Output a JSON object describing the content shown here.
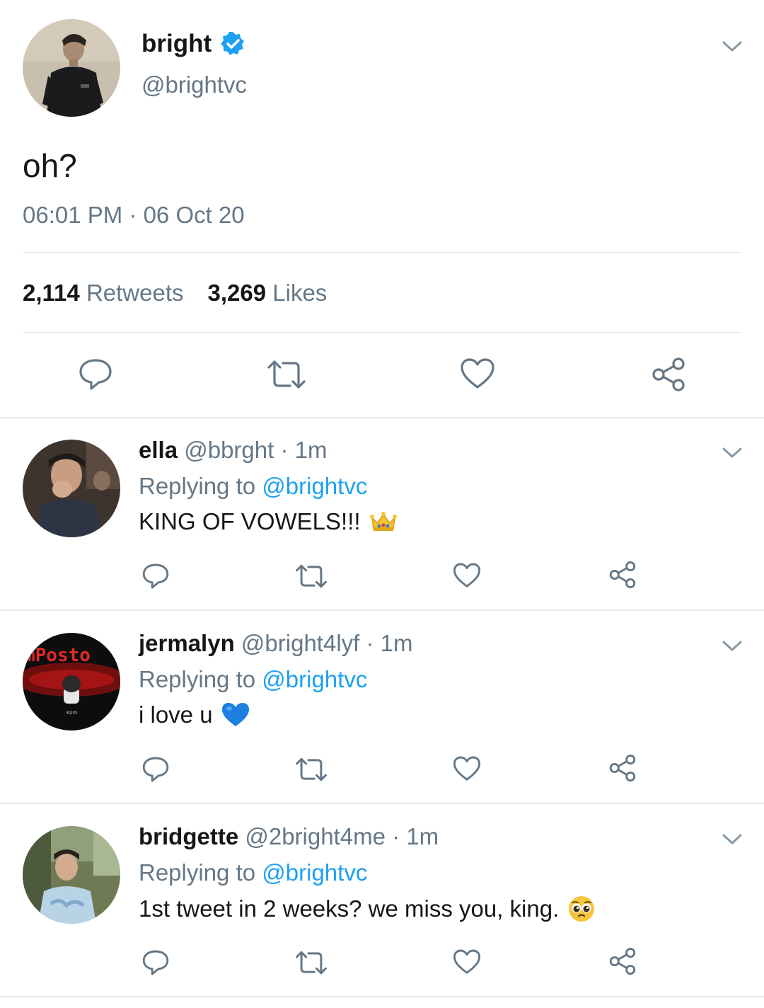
{
  "main_tweet": {
    "display_name": "bright",
    "handle": "@brightvc",
    "text": "oh?",
    "timestamp": "06:01 PM · 06 Oct 20",
    "retweets_count": "2,114",
    "retweets_label": "Retweets",
    "likes_count": "3,269",
    "likes_label": "Likes"
  },
  "replies": [
    {
      "name": "ella",
      "meta": "@bbrght · 1m",
      "replying_prefix": "Replying to",
      "replying_to": "@brightvc",
      "text": "KING OF VOWELS!!!",
      "emoji": "crown-emoji"
    },
    {
      "name": "jermalyn",
      "meta": "@bright4lyf · 1m",
      "replying_prefix": "Replying to",
      "replying_to": "@brightvc",
      "text": "i love u",
      "emoji": "blue-heart-emoji",
      "avatar_text": "mPosto",
      "avatar_sub": "Kom"
    },
    {
      "name": "bridgette",
      "meta": "@2bright4me · 1m",
      "replying_prefix": "Replying to",
      "replying_to": "@brightvc",
      "text": "1st tweet in 2 weeks? we miss you, king.",
      "emoji": "pleading-face-emoji"
    }
  ],
  "colors": {
    "text": "#14171a",
    "secondary": "#657786",
    "accent": "#1da1f2",
    "divider": "#e1e8ed"
  }
}
